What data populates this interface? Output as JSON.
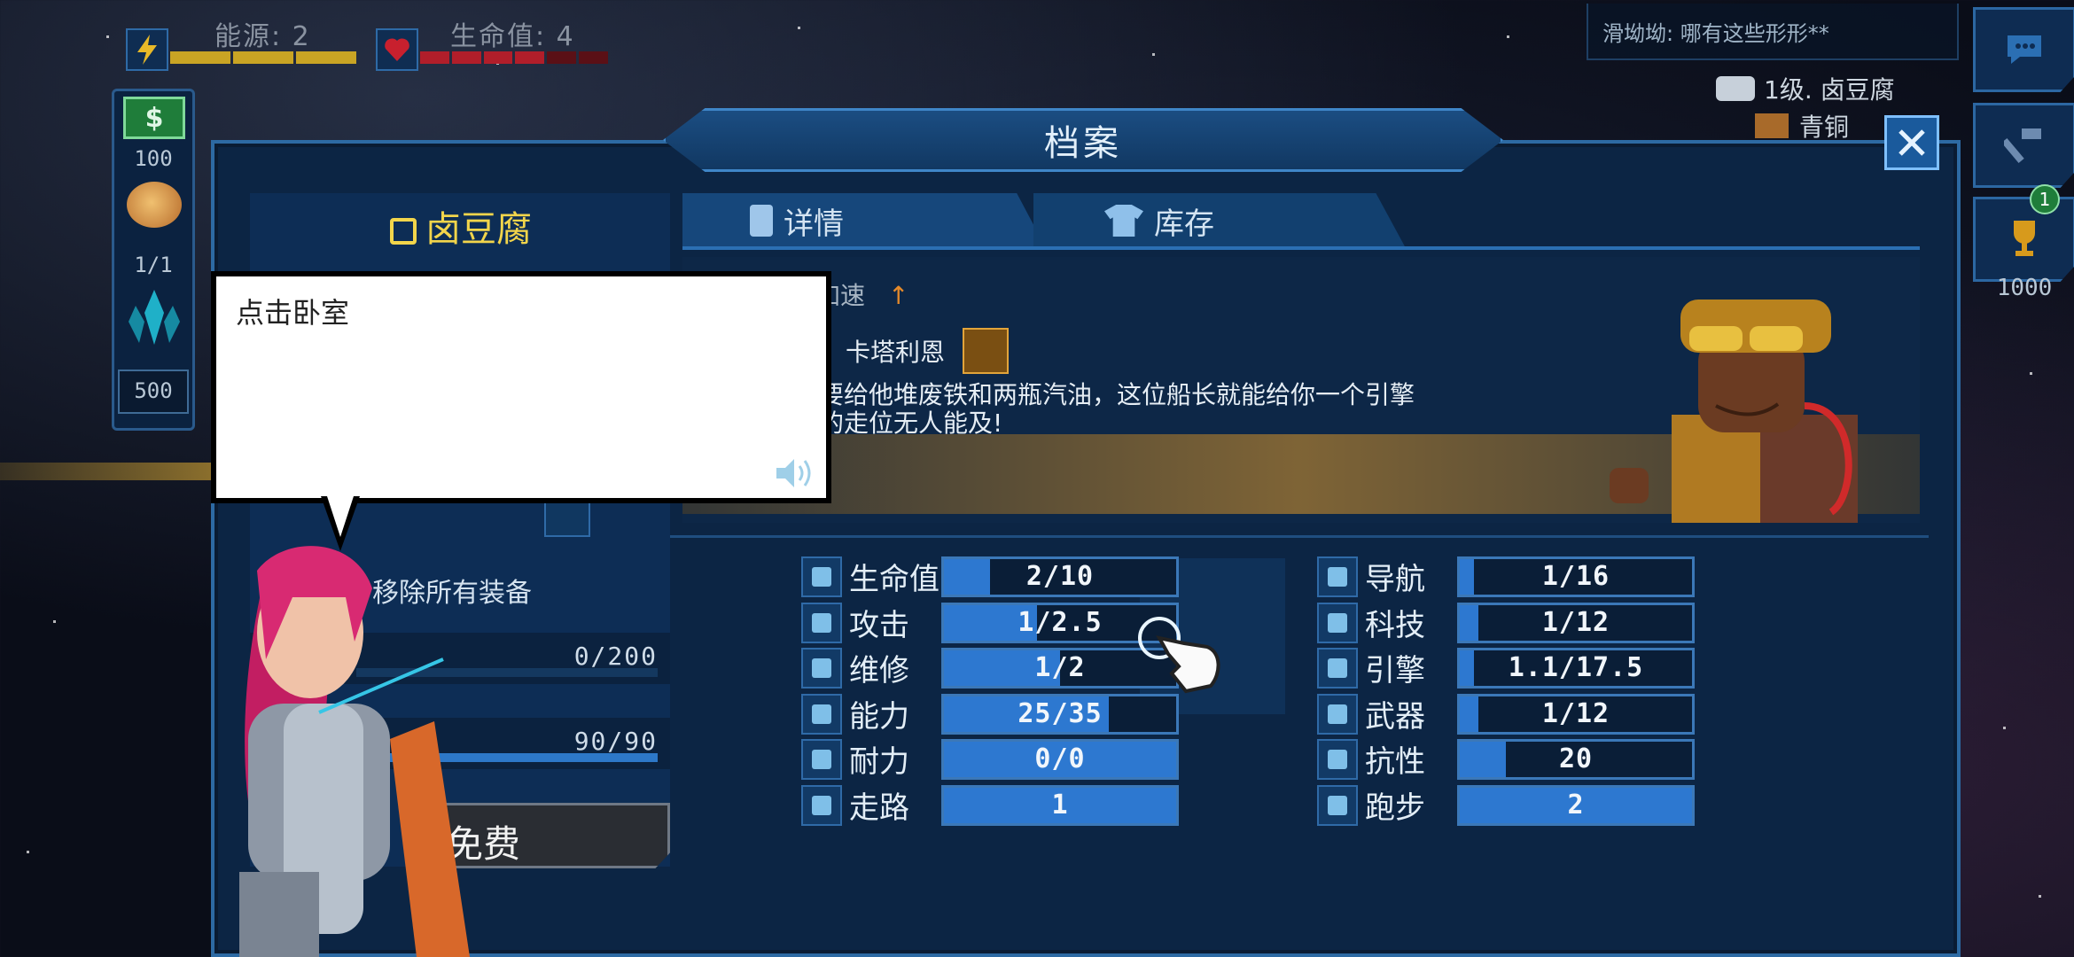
{
  "hud": {
    "energy_label": "能源: 2",
    "life_label": "生命值: 4",
    "energy_icon": "lightning-icon",
    "life_icon": "heart-icon"
  },
  "resources": {
    "money_icon": "dollar-icon",
    "money": "100",
    "crew_count": "1/1",
    "crystal": "500"
  },
  "chat": {
    "message": "滑坳坳: 哪有这些形形**"
  },
  "ship": {
    "level_label": "1级. 卤豆腐",
    "rank_label": "青铜"
  },
  "trophy": {
    "badge": "1",
    "score": "1000"
  },
  "panel": {
    "title": "档案",
    "close_icon": "close-icon"
  },
  "crew": {
    "name": "卤豆腐",
    "remove_all": "移除所有装备",
    "stat1_value": "0/200",
    "stat2_value": "90/90",
    "free_button": "免费"
  },
  "tabs": {
    "details": "详情",
    "inventory": "库存"
  },
  "card": {
    "speed_label": "加速",
    "captain_name": "卡塔利恩",
    "description_line1": "要给他堆废铁和两瓶汽油，这位船长就能给你一个引擎",
    "description_line2": "的走位无人能及!"
  },
  "stats_left": [
    {
      "label": "生命值",
      "value": "2/10",
      "fill": 0.2,
      "icon": "heart-icon"
    },
    {
      "label": "攻击",
      "value": "1/2.5",
      "fill": 0.4,
      "icon": "sword-icon"
    },
    {
      "label": "维修",
      "value": "1/2",
      "fill": 0.5,
      "icon": "hammer-icon"
    },
    {
      "label": "能力",
      "value": "25/35",
      "fill": 0.71,
      "icon": "figure-icon"
    },
    {
      "label": "耐力",
      "value": "0/0",
      "fill": 1.0,
      "icon": "boot-icon"
    },
    {
      "label": "走路",
      "value": "1",
      "fill": 1.0,
      "icon": "walk-icon"
    }
  ],
  "stats_right": [
    {
      "label": "导航",
      "value": "1/16",
      "fill": 0.06,
      "icon": "navigation-icon"
    },
    {
      "label": "科技",
      "value": "1/12",
      "fill": 0.08,
      "icon": "flask-icon"
    },
    {
      "label": "引擎",
      "value": "1.1/17.5",
      "fill": 0.06,
      "icon": "engine-icon"
    },
    {
      "label": "武器",
      "value": "1/12",
      "fill": 0.08,
      "icon": "crosshair-icon"
    },
    {
      "label": "抗性",
      "value": "20",
      "fill": 0.2,
      "icon": "flame-icon"
    },
    {
      "label": "跑步",
      "value": "2",
      "fill": 1.0,
      "icon": "run-icon"
    }
  ],
  "tutorial": {
    "text": "点击卧室",
    "audio_icon": "speaker-icon",
    "pointer_icon": "hand-pointer-icon"
  },
  "colors": {
    "accent": "#2d78d0",
    "panel_bg": "#0c2544",
    "gold": "#f2d54b",
    "energy": "#c9a424",
    "life": "#b11e2a"
  }
}
